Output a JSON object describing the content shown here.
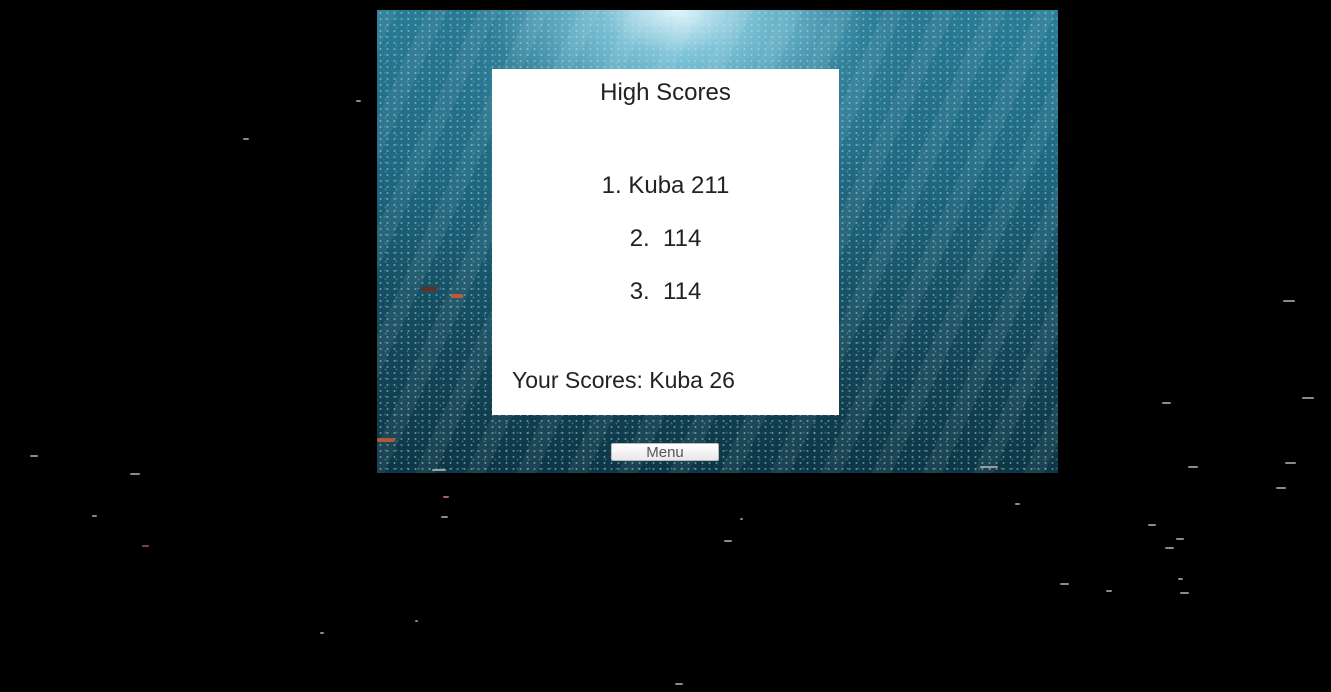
{
  "highscores": {
    "title": "High Scores",
    "entries": [
      {
        "text": "1. Kuba 211"
      },
      {
        "text": "2.  114"
      },
      {
        "text": "3.  114"
      }
    ],
    "your_score": "Your Scores: Kuba 26"
  },
  "menu": {
    "label": "Menu"
  },
  "colors": {
    "background": "#000000",
    "water_light": "#2b7f98",
    "water_dark": "#0e3645",
    "panel": "#ffffff",
    "text": "#222222"
  }
}
